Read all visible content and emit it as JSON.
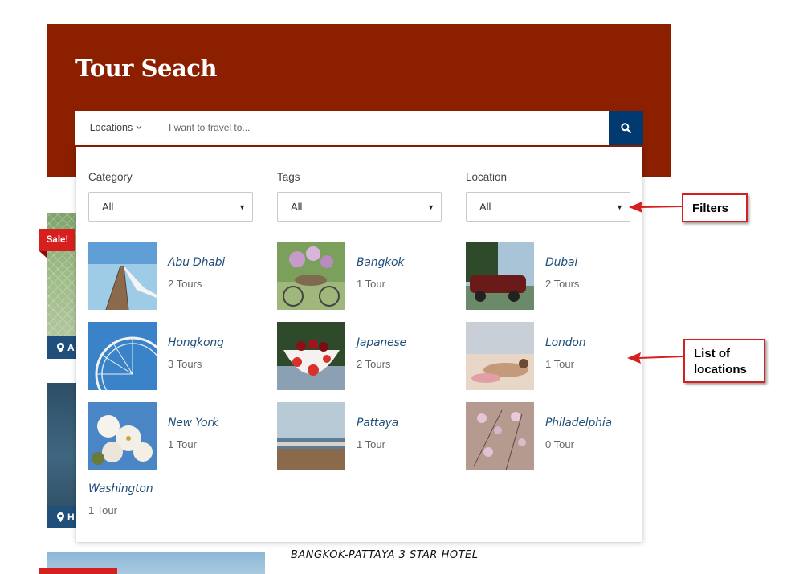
{
  "hero": {
    "title": "Tour Seach",
    "color": "#8b1f00"
  },
  "search": {
    "locations_label": "Locations",
    "placeholder": "I want to travel to...",
    "button_icon": "search-icon",
    "button_color": "#003a70"
  },
  "filters": [
    {
      "label": "Category",
      "value": "All"
    },
    {
      "label": "Tags",
      "value": "All"
    },
    {
      "label": "Location",
      "value": "All"
    }
  ],
  "locations": [
    {
      "name": "Abu Dhabi",
      "count": "2 Tours"
    },
    {
      "name": "Bangkok",
      "count": "1 Tour"
    },
    {
      "name": "Dubai",
      "count": "2 Tours"
    },
    {
      "name": "Hongkong",
      "count": "3 Tours"
    },
    {
      "name": "Japanese",
      "count": "2 Tours"
    },
    {
      "name": "London",
      "count": "1 Tour"
    },
    {
      "name": "New York",
      "count": "1 Tour"
    },
    {
      "name": "Pattaya",
      "count": "1 Tour"
    },
    {
      "name": "Philadelphia",
      "count": "0 Tour"
    },
    {
      "name": "Washington",
      "count": "1 Tour"
    }
  ],
  "background": {
    "sale_badge": "Sale!",
    "card1_strip": "A",
    "card2_strip": "H",
    "hotel_title": "BANGKOK-PATTAYA 3 STAR HOTEL"
  },
  "annotations": {
    "filters": "Filters",
    "list_line1": "List of",
    "list_line2": "locations",
    "color": "#d61f1f"
  }
}
